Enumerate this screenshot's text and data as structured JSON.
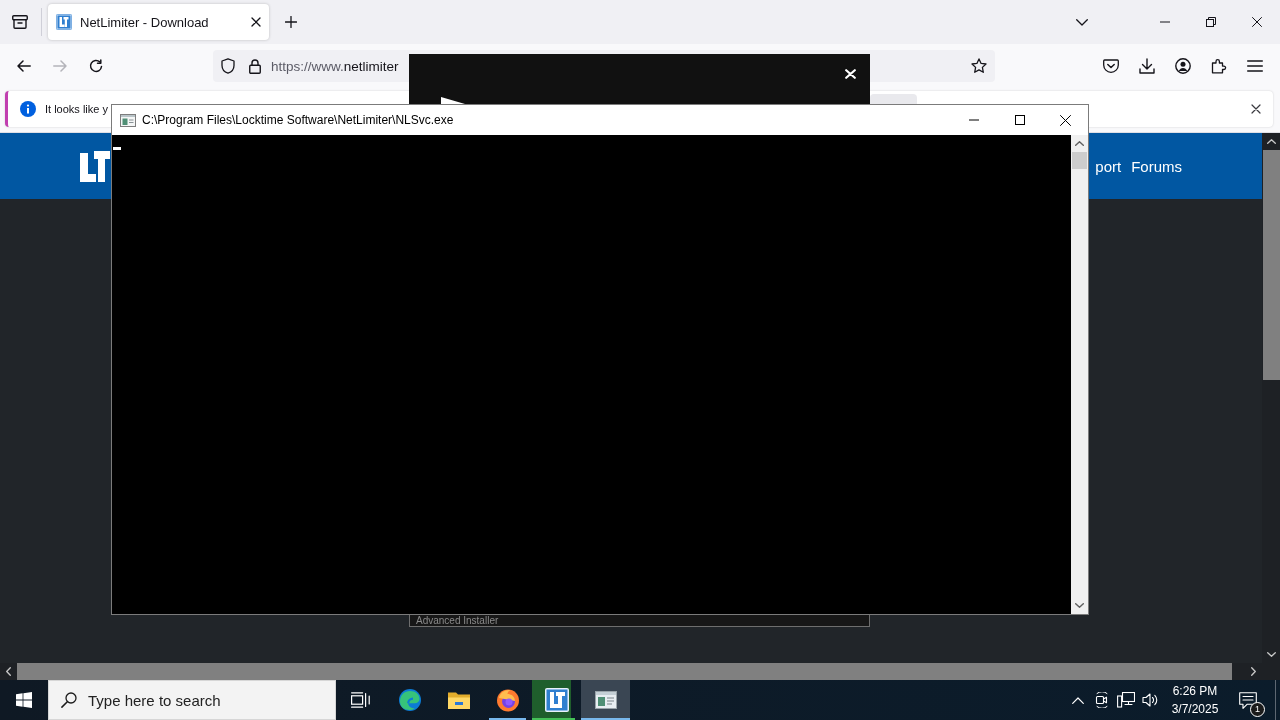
{
  "browser": {
    "tabs": [
      {
        "title": "NetLimiter - Download",
        "selected": true
      }
    ],
    "toolbar": [
      {
        "kind": "back",
        "disabled": false
      },
      {
        "kind": "forward",
        "disabled": true
      },
      {
        "kind": "reload",
        "disabled": false
      }
    ],
    "address_bar": {
      "url_prefix": "https://www.",
      "url_host": "netlimiter"
    },
    "notification": {
      "text": "It looks like y"
    },
    "page": {
      "nav_links": [
        "port",
        "Forums"
      ]
    },
    "popup": {
      "footer_text": "Advanced Installer"
    }
  },
  "console_window": {
    "title": "C:\\Program Files\\Locktime Software\\NetLimiter\\NLSvc.exe"
  },
  "taskbar": {
    "search": {
      "placeholder": "Type here to search"
    },
    "apps": [
      {
        "kind": "edge",
        "running": false,
        "selected": false
      },
      {
        "kind": "explorer",
        "running": false,
        "selected": false
      },
      {
        "kind": "firefox",
        "running": true,
        "selected": false
      },
      {
        "kind": "netlimiter",
        "running": true,
        "selected": false,
        "level": 0.8
      },
      {
        "kind": "console",
        "running": true,
        "selected": true
      }
    ],
    "clock": {
      "time": "6:26 PM",
      "date": "3/7/2025"
    },
    "notification_count": "1"
  }
}
